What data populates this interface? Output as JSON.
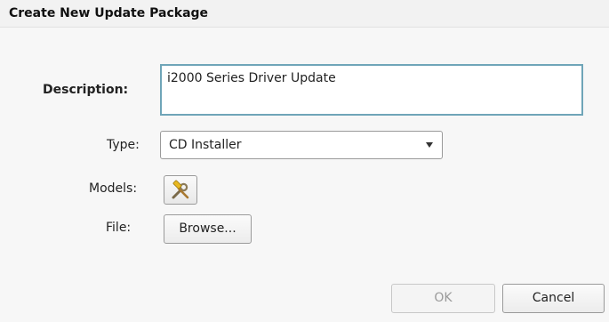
{
  "dialog": {
    "title": "Create New Update Package"
  },
  "form": {
    "description_label": "Description:",
    "description_value": "i2000 Series Driver Update",
    "type_label": "Type:",
    "type_value": "CD Installer",
    "models_label": "Models:",
    "models_button_icon": "tools-icon",
    "file_label": "File:",
    "browse_label": "Browse..."
  },
  "footer": {
    "ok_label": "OK",
    "cancel_label": "Cancel",
    "ok_enabled": false
  }
}
